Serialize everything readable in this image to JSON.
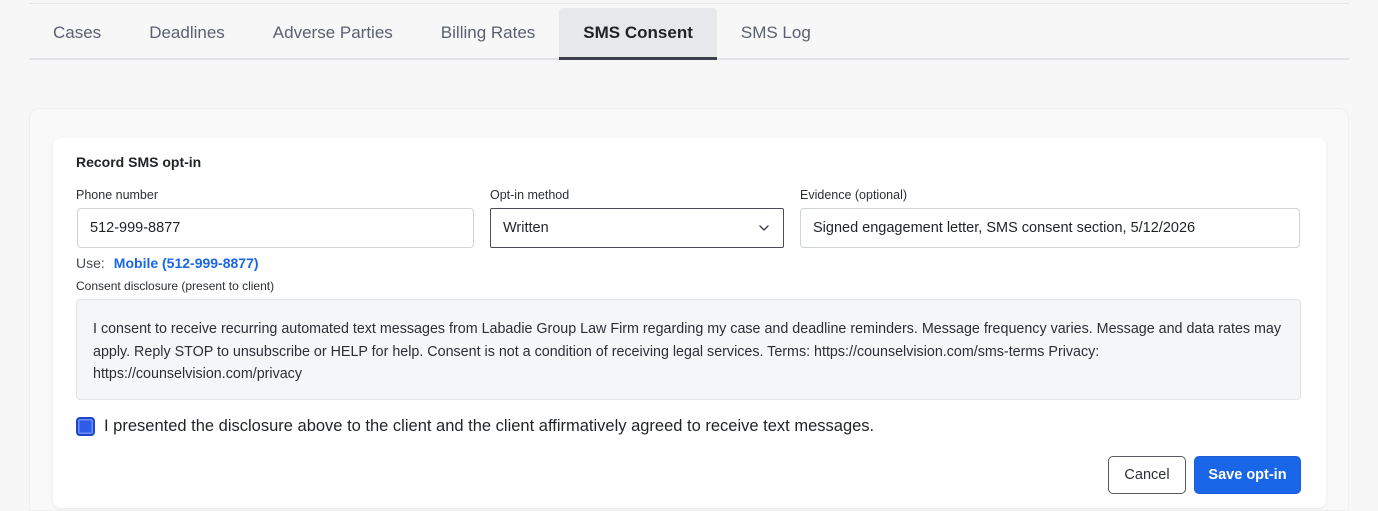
{
  "tabs": [
    {
      "label": "Cases",
      "active": false
    },
    {
      "label": "Deadlines",
      "active": false
    },
    {
      "label": "Adverse Parties",
      "active": false
    },
    {
      "label": "Billing Rates",
      "active": false
    },
    {
      "label": "SMS Consent",
      "active": true
    },
    {
      "label": "SMS Log",
      "active": false
    }
  ],
  "form": {
    "title": "Record SMS opt-in",
    "phone": {
      "label": "Phone number",
      "value": "512-999-8877"
    },
    "method": {
      "label": "Opt-in method",
      "value": "Written",
      "icon": "chevron-down-icon"
    },
    "evidence": {
      "label": "Evidence (optional)",
      "value": "Signed engagement letter, SMS consent section, 5/12/2026"
    },
    "use_label": "Use:",
    "use_link": "Mobile (512-999-8877)",
    "disclosure_label": "Consent disclosure (present to client)",
    "disclosure_text": "I consent to receive recurring automated text messages from Labadie Group Law Firm regarding my case and deadline reminders. Message frequency varies. Message and data rates may apply. Reply STOP to unsubscribe or HELP for help. Consent is not a condition of receiving legal services. Terms: https://counselvision.com/sms-terms Privacy: https://counselvision.com/privacy",
    "checkbox_checked": true,
    "checkbox_label": "I presented the disclosure above to the client and the client affirmatively agreed to receive text messages.",
    "cancel_label": "Cancel",
    "save_label": "Save opt-in"
  },
  "colors": {
    "accent": "#1a66e8",
    "checkbox": "#2e5bea"
  }
}
